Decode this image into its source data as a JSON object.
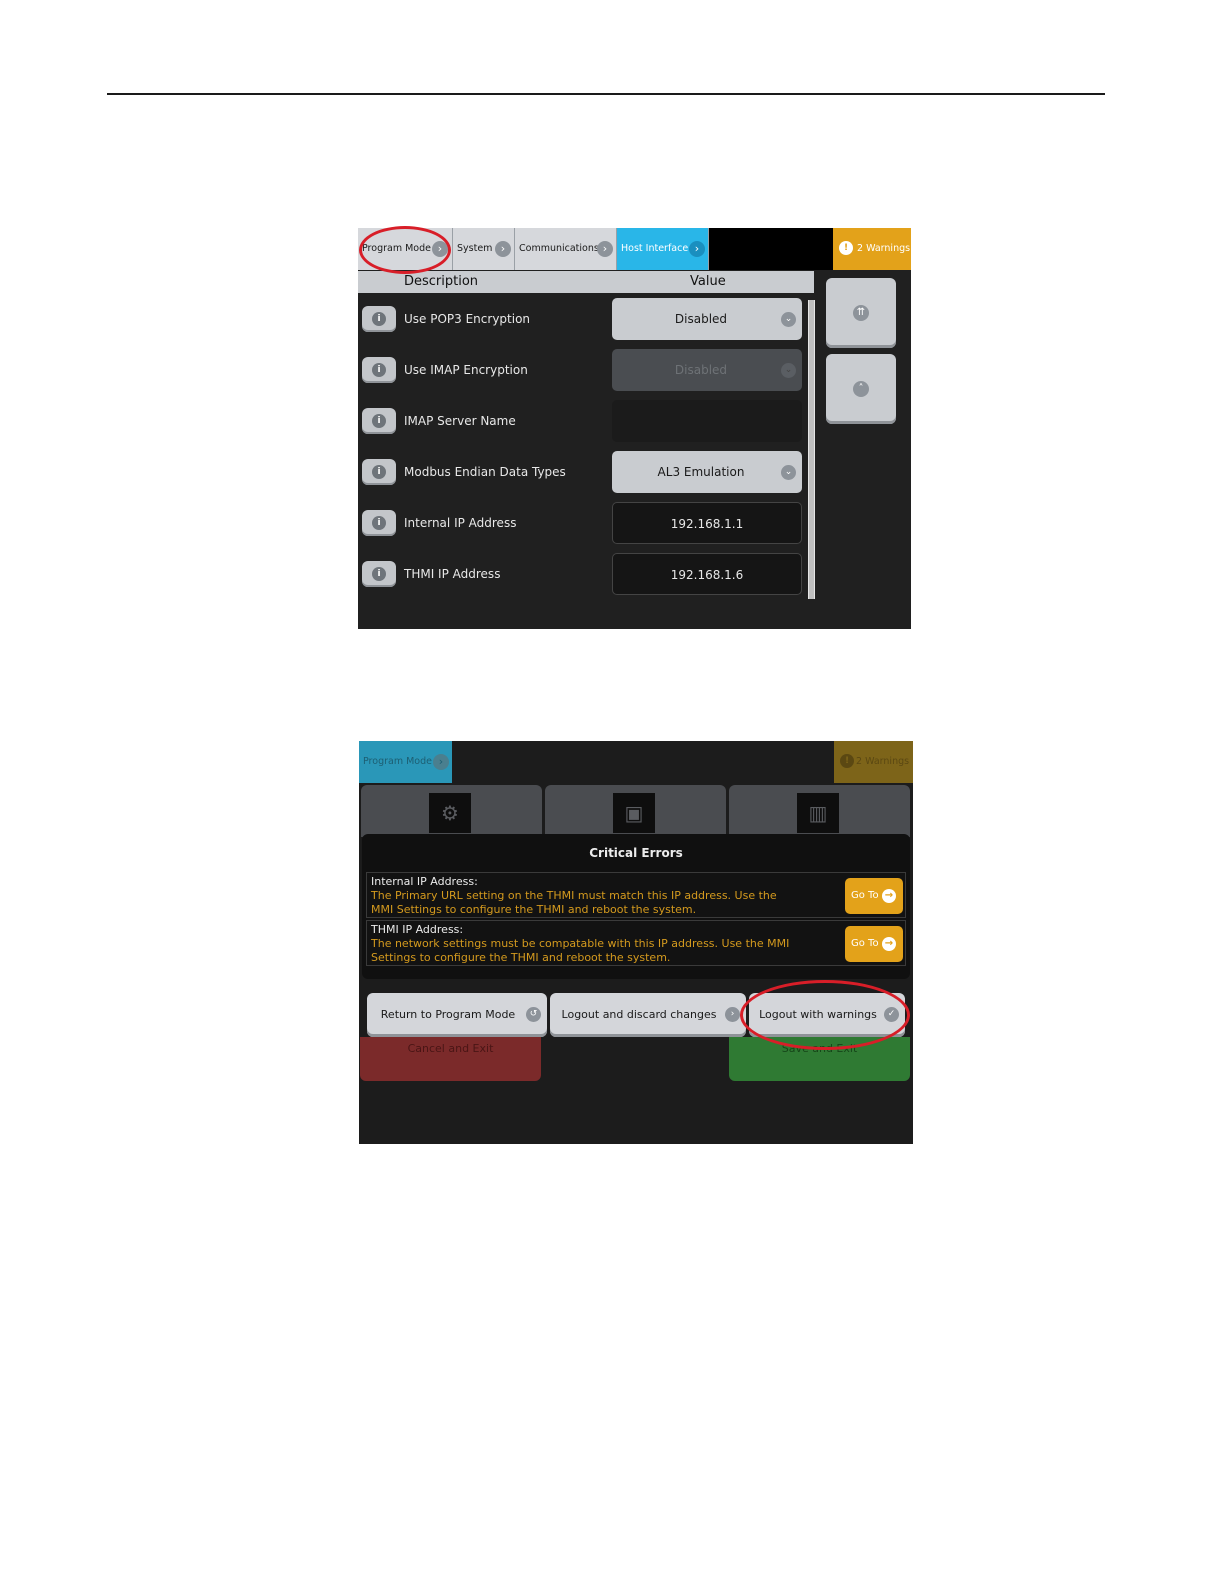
{
  "screen1": {
    "breadcrumbs": [
      "Program Mode",
      "System",
      "Communications",
      "Host Interface"
    ],
    "warnings": "2 Warnings",
    "columns": {
      "description": "Description",
      "value": "Value"
    },
    "rows": [
      {
        "label": "Use POP3 Encryption",
        "value": "Disabled",
        "kind": "dropdown"
      },
      {
        "label": "Use IMAP Encryption",
        "value": "Disabled",
        "kind": "dropdown-disabled"
      },
      {
        "label": "IMAP Server Name",
        "value": "",
        "kind": "empty"
      },
      {
        "label": "Modbus Endian Data Types",
        "value": "AL3 Emulation",
        "kind": "dropdown"
      },
      {
        "label": "Internal IP Address",
        "value": "192.168.1.1",
        "kind": "field"
      },
      {
        "label": "THMI IP Address",
        "value": "192.168.1.6",
        "kind": "field"
      }
    ]
  },
  "screen2": {
    "breadcrumb": "Program Mode",
    "warnings": "2 Warnings",
    "dialog": {
      "title": "Critical Errors",
      "errors": [
        {
          "heading": "Internal IP Address:",
          "message": "The Primary URL setting on the THMI must match this IP address. Use the MMI Settings to configure the THMI and reboot the system.",
          "button": "Go To"
        },
        {
          "heading": "THMI IP Address:",
          "message": "The network settings must be compatable with this IP address. Use the MMI Settings to configure the THMI and reboot the system.",
          "button": "Go To"
        }
      ]
    },
    "actions": {
      "return": "Return to Program Mode",
      "discard": "Logout and discard changes",
      "warnings": "Logout with warnings"
    },
    "cancel_exit": "Cancel and Exit",
    "save_exit": "Save and Exit"
  },
  "colors": {
    "accent_blue": "#29b6e8",
    "warning_amber": "#e3a21a",
    "highlight_red": "#d81e28",
    "error_text": "#d49a1e"
  },
  "icons": [
    "chevron-right-icon",
    "warning-icon",
    "info-icon",
    "chevron-down-icon",
    "double-chevron-up-icon",
    "chevron-up-icon",
    "arrow-right-icon",
    "check-icon",
    "back-icon"
  ]
}
